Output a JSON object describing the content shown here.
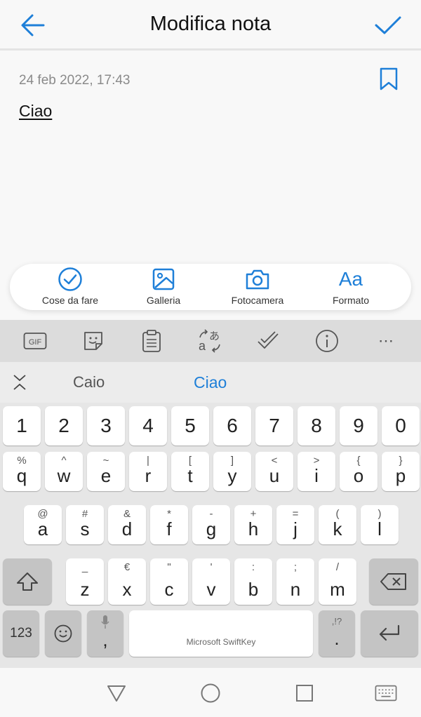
{
  "header": {
    "title": "Modifica nota"
  },
  "note": {
    "date": "24 feb 2022, 17:43",
    "text": "Ciao"
  },
  "actions": [
    {
      "label": "Cose da fare",
      "icon": "check-circle-icon"
    },
    {
      "label": "Galleria",
      "icon": "gallery-icon"
    },
    {
      "label": "Fotocamera",
      "icon": "camera-icon"
    },
    {
      "label": "Formato",
      "icon": "format-icon",
      "glyph": "Aa"
    }
  ],
  "keyboard": {
    "toolbar": {
      "gif_label": "GIF",
      "more": "⋯"
    },
    "suggestions": [
      "Caio",
      "Ciao"
    ],
    "row_numbers": [
      "1",
      "2",
      "3",
      "4",
      "5",
      "6",
      "7",
      "8",
      "9",
      "0"
    ],
    "row1": [
      {
        "k": "q",
        "a": "%"
      },
      {
        "k": "w",
        "a": "^"
      },
      {
        "k": "e",
        "a": "~"
      },
      {
        "k": "r",
        "a": "|"
      },
      {
        "k": "t",
        "a": "["
      },
      {
        "k": "y",
        "a": "]"
      },
      {
        "k": "u",
        "a": "<"
      },
      {
        "k": "i",
        "a": ">"
      },
      {
        "k": "o",
        "a": "{"
      },
      {
        "k": "p",
        "a": "}"
      }
    ],
    "row2": [
      {
        "k": "a",
        "a": "@"
      },
      {
        "k": "s",
        "a": "#"
      },
      {
        "k": "d",
        "a": "&"
      },
      {
        "k": "f",
        "a": "*"
      },
      {
        "k": "g",
        "a": "-"
      },
      {
        "k": "h",
        "a": "+"
      },
      {
        "k": "j",
        "a": "="
      },
      {
        "k": "k",
        "a": "("
      },
      {
        "k": "l",
        "a": ")"
      }
    ],
    "row3": [
      {
        "k": "z",
        "a": "_"
      },
      {
        "k": "x",
        "a": "€"
      },
      {
        "k": "c",
        "a": "\""
      },
      {
        "k": "v",
        "a": "'"
      },
      {
        "k": "b",
        "a": ":"
      },
      {
        "k": "n",
        "a": ";"
      },
      {
        "k": "m",
        "a": "/"
      }
    ],
    "bottom": {
      "num_key": "123",
      "comma": ",",
      "period": ".",
      "period_alt": ",!?",
      "space_brand": "Microsoft SwiftKey"
    }
  },
  "colors": {
    "accent": "#1e7fd8"
  }
}
